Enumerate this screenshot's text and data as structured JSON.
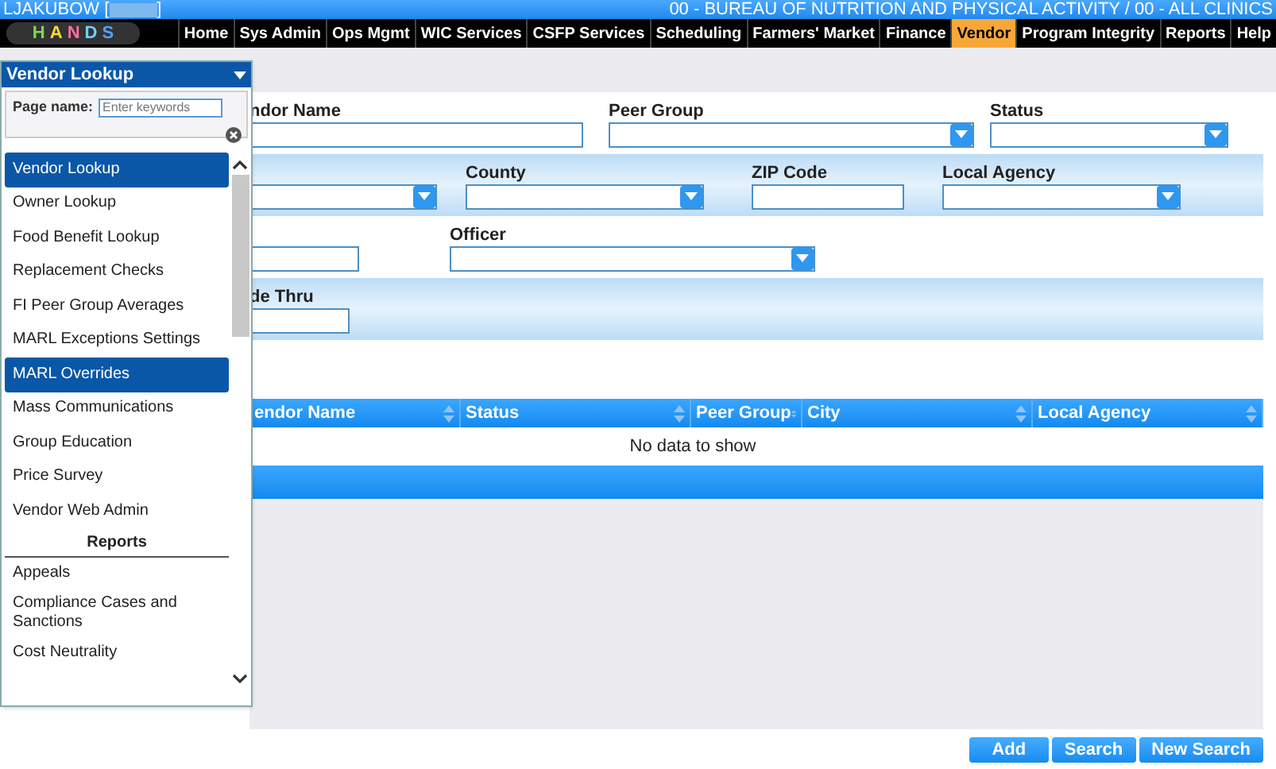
{
  "title_bar": {
    "user": "LJAKUBOW [",
    "user_end": "]",
    "context": "00 - BUREAU OF NUTRITION AND PHYSICAL ACTIVITY / 00 - ALL CLINICS"
  },
  "logo": {
    "letters": [
      "H",
      "A",
      "N",
      "D",
      "S"
    ]
  },
  "nav": [
    {
      "label": "Home",
      "selected": false
    },
    {
      "label": "Sys Admin",
      "selected": false
    },
    {
      "label": "Ops Mgmt",
      "selected": false
    },
    {
      "label": "WIC Services",
      "selected": false
    },
    {
      "label": "CSFP Services",
      "selected": false
    },
    {
      "label": "Scheduling",
      "selected": false
    },
    {
      "label": "Farmers' Market",
      "selected": false
    },
    {
      "label": "Finance",
      "selected": false
    },
    {
      "label": "Vendor",
      "selected": true
    },
    {
      "label": "Program Integrity",
      "selected": false
    },
    {
      "label": "Reports",
      "selected": false
    },
    {
      "label": "Help",
      "selected": false
    }
  ],
  "page_menu": {
    "title": "Vendor Lookup",
    "search_label": "Page name:",
    "search_placeholder": "Enter keywords",
    "items": [
      {
        "kind": "item",
        "label": "Vendor Lookup",
        "selected": true
      },
      {
        "kind": "item",
        "label": "Owner Lookup",
        "selected": false
      },
      {
        "kind": "item",
        "label": "Food Benefit Lookup",
        "selected": false
      },
      {
        "kind": "item",
        "label": "Replacement Checks",
        "selected": false
      },
      {
        "kind": "item",
        "label": "FI Peer Group Averages",
        "selected": false
      },
      {
        "kind": "item",
        "label": "MARL Exceptions Settings",
        "selected": false
      },
      {
        "kind": "item",
        "label": "MARL Overrides",
        "selected": true
      },
      {
        "kind": "item",
        "label": "Mass Communications",
        "selected": false
      },
      {
        "kind": "item",
        "label": "Group Education",
        "selected": false
      },
      {
        "kind": "item",
        "label": "Price Survey",
        "selected": false
      },
      {
        "kind": "item",
        "label": "Vendor Web Admin",
        "selected": false
      },
      {
        "kind": "heading",
        "label": "Reports"
      },
      {
        "kind": "item",
        "label": "Appeals",
        "selected": false
      },
      {
        "kind": "item",
        "label": "Compliance Cases and Sanctions",
        "selected": false
      },
      {
        "kind": "item",
        "label": "Cost Neutrality",
        "selected": false
      }
    ]
  },
  "form_rows": [
    {
      "shaded": false,
      "fields": [
        {
          "kind": "input",
          "label": "ndor Name"
        },
        {
          "kind": "select",
          "label": "Peer Group"
        },
        {
          "kind": "select",
          "label": "Status"
        }
      ]
    },
    {
      "shaded": true,
      "fields": [
        {
          "kind": "select"
        },
        {
          "kind": "select",
          "label": "County"
        },
        {
          "kind": "input",
          "label": "ZIP Code"
        },
        {
          "kind": "select",
          "label": "Local Agency"
        }
      ]
    },
    {
      "shaded": false,
      "fields": [
        {
          "kind": "input"
        },
        {
          "kind": "select",
          "label": "Officer"
        }
      ]
    },
    {
      "shaded": true,
      "fields": [
        {
          "kind": "input",
          "label": "de Thru"
        }
      ]
    }
  ],
  "results_table": {
    "columns": [
      "endor Name",
      "Status",
      "Peer Group",
      "City",
      "Local Agency"
    ],
    "empty_message": "No data to show"
  },
  "buttons": [
    "Add",
    "Search",
    "New Search"
  ]
}
